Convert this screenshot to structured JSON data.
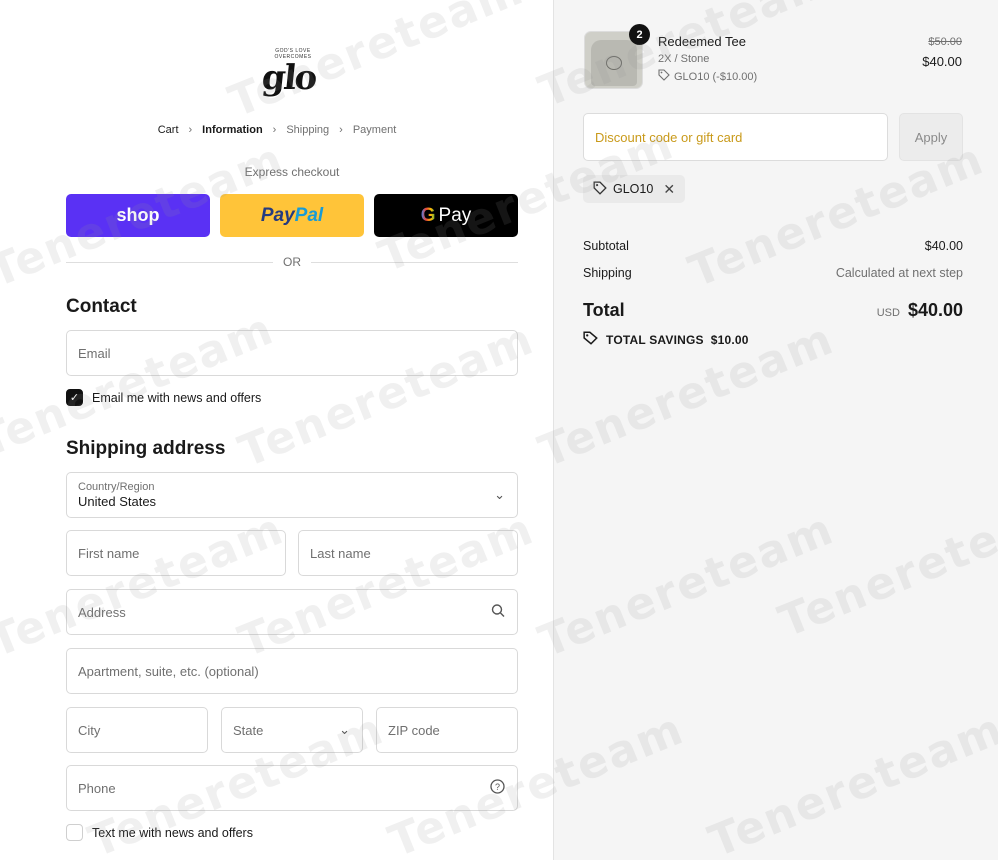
{
  "logo": {
    "brand": "glo",
    "tagline": "GOD'S LOVE OVERCOMES"
  },
  "breadcrumb": [
    {
      "label": "Cart",
      "state": "done"
    },
    {
      "label": "Information",
      "state": "active"
    },
    {
      "label": "Shipping",
      "state": "upcoming"
    },
    {
      "label": "Payment",
      "state": "upcoming"
    }
  ],
  "express": {
    "label": "Express checkout",
    "shop": "shop",
    "paypal_1": "Pay",
    "paypal_2": "Pal",
    "gpay_g": "G",
    "gpay_text": "Pay",
    "or": "OR"
  },
  "contact": {
    "title": "Contact",
    "email_placeholder": "Email",
    "news_label": "Email me with news and offers",
    "news_checked": true
  },
  "shipping": {
    "title": "Shipping address",
    "country_label": "Country/Region",
    "country_value": "United States",
    "first_name_placeholder": "First name",
    "last_name_placeholder": "Last name",
    "address_placeholder": "Address",
    "apartment_placeholder": "Apartment, suite, etc. (optional)",
    "city_placeholder": "City",
    "state_placeholder": "State",
    "zip_placeholder": "ZIP code",
    "phone_placeholder": "Phone",
    "sms_label": "Text me with news and offers",
    "sms_checked": false
  },
  "cart": {
    "quantity": "2",
    "product_name": "Redeemed Tee",
    "variant": "2X / Stone",
    "discount_line": "GLO10 (-$10.00)",
    "price_original": "$50.00",
    "price_current": "$40.00"
  },
  "discount": {
    "placeholder": "Discount code or gift card",
    "apply": "Apply",
    "applied_code": "GLO10"
  },
  "summary": {
    "subtotal_label": "Subtotal",
    "subtotal_value": "$40.00",
    "shipping_label": "Shipping",
    "shipping_value": "Calculated at next step",
    "total_label": "Total",
    "currency": "USD",
    "total_value": "$40.00",
    "savings_label": "TOTAL SAVINGS",
    "savings_value": "$10.00"
  },
  "watermark_text": "Tenereteam",
  "colors": {
    "shop_pay": "#5a31f4",
    "paypal": "#ffc439",
    "gpay": "#000000",
    "discount_placeholder": "#c99a1a"
  }
}
